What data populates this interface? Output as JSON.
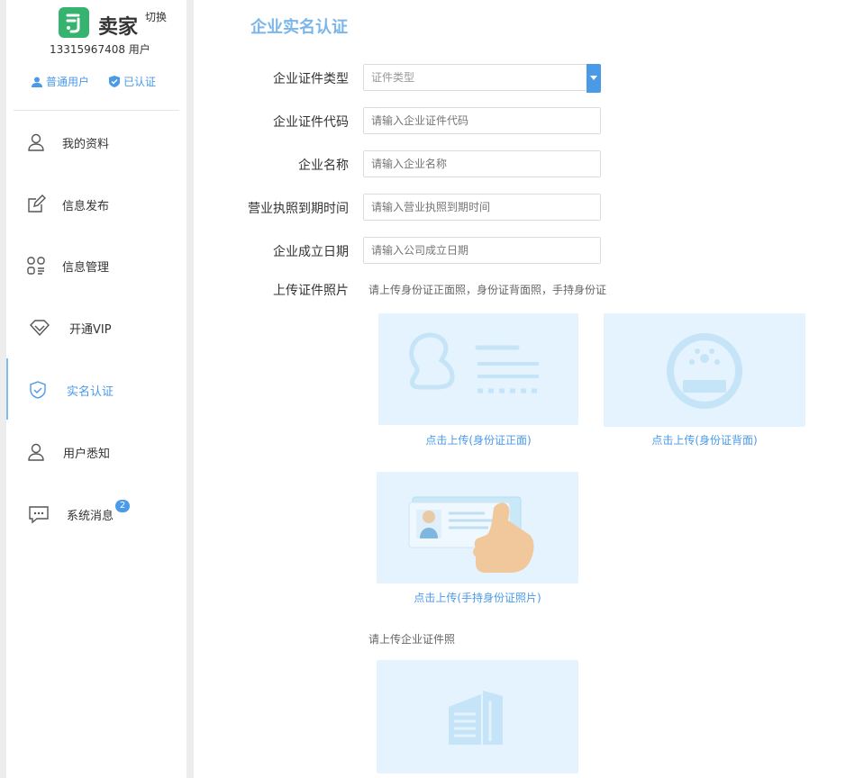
{
  "sidebar": {
    "brand": "卖家",
    "switch_label": "切换",
    "phone_line": "13315967408 用户",
    "user_type": "普通用户",
    "verify_status": "已认证",
    "items": [
      {
        "label": "我的资料",
        "icon": "user-icon"
      },
      {
        "label": "信息发布",
        "icon": "edit-icon"
      },
      {
        "label": "信息管理",
        "icon": "grid-list-icon"
      },
      {
        "label": "开通VIP",
        "icon": "diamond-icon"
      },
      {
        "label": "实名认证",
        "icon": "shield-check-icon",
        "active": true
      },
      {
        "label": "用户悉知",
        "icon": "user-outline-icon"
      },
      {
        "label": "系统消息",
        "icon": "chat-icon",
        "badge": "2"
      }
    ],
    "accent_color": "#4a9ae8"
  },
  "main": {
    "title": "企业实名认证",
    "fields": [
      {
        "label": "企业证件类型",
        "placeholder": "证件类型",
        "type": "select"
      },
      {
        "label": "企业证件代码",
        "placeholder": "请输入企业证件代码"
      },
      {
        "label": "企业名称",
        "placeholder": "请输入企业名称"
      },
      {
        "label": "营业执照到期时间",
        "placeholder": "请输入营业执照到期时间"
      },
      {
        "label": "企业成立日期",
        "placeholder": "请输入公司成立日期"
      }
    ],
    "upload_label": "上传证件照片",
    "upload_hint": "请上传身份证正面照，身份证背面照，手持身份证",
    "uploads": [
      {
        "caption": "点击上传(身份证正面)",
        "icon": "id-card-front-icon"
      },
      {
        "caption": "点击上传(身份证背面)",
        "icon": "id-card-back-icon"
      },
      {
        "caption": "点击上传(手持身份证照片)",
        "icon": "hand-id-icon"
      }
    ],
    "company_hint": "请上传企业证件照",
    "company_upload_icon": "building-icon"
  }
}
